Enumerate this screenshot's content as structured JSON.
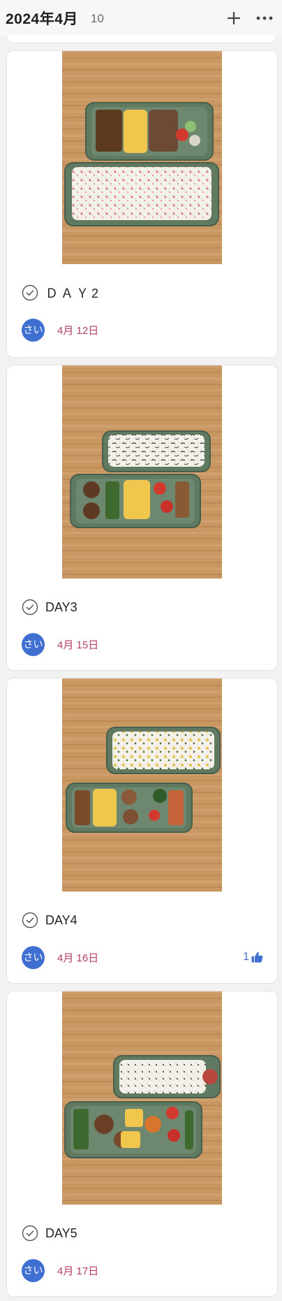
{
  "header": {
    "title": "2024年4月",
    "count": "10",
    "add_icon": "plus-icon",
    "more_icon": "more-horizontal-icon"
  },
  "colors": {
    "avatar": "#3f6fd0",
    "date": "#b23d6a",
    "like": "#3f6fd0",
    "tray": "#667f67",
    "wood": "#c99763"
  },
  "cards": [
    {
      "title": "ＤＡＹ2",
      "avatar": "さい",
      "date": "4月 12日",
      "photo": "bento-day2"
    },
    {
      "title": "DAY3",
      "avatar": "さい",
      "date": "4月 15日",
      "photo": "bento-day3"
    },
    {
      "title": "DAY4",
      "avatar": "さい",
      "date": "4月 16日",
      "photo": "bento-day4",
      "likes": "1"
    },
    {
      "title": "DAY5",
      "avatar": "さい",
      "date": "4月 17日",
      "photo": "bento-day5"
    }
  ]
}
